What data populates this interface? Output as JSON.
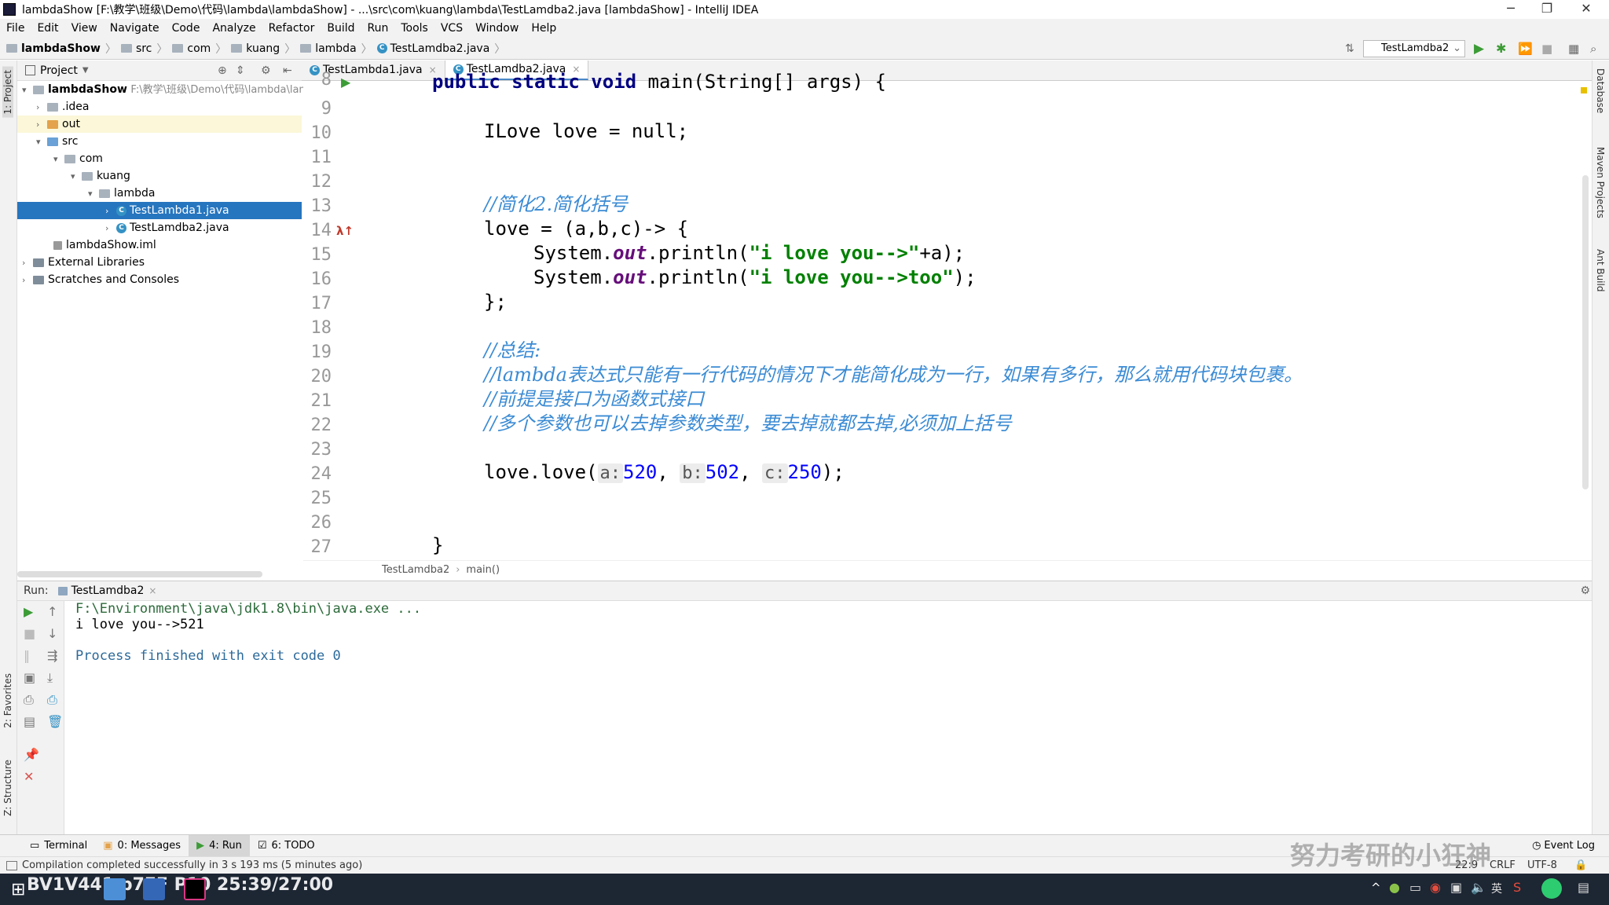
{
  "window": {
    "title": "lambdaShow [F:\\教学\\班级\\Demo\\代码\\lambda\\lambdaShow] - ...\\src\\com\\kuang\\lambda\\TestLamdba2.java [lambdaShow] - IntelliJ IDEA",
    "min": "─",
    "max": "❐",
    "close": "✕"
  },
  "menu": [
    "File",
    "Edit",
    "View",
    "Navigate",
    "Code",
    "Analyze",
    "Refactor",
    "Build",
    "Run",
    "Tools",
    "VCS",
    "Window",
    "Help"
  ],
  "breadcrumb": [
    "lambdaShow",
    "src",
    "com",
    "kuang",
    "lambda",
    "TestLamdba2.java"
  ],
  "run_config": "TestLamdba2",
  "project_panel": {
    "title": "Project",
    "tree": [
      {
        "label": "lambdaShow",
        "extra": "F:\\教学\\班级\\Demo\\代码\\lambda\\lam"
      },
      {
        "label": ".idea"
      },
      {
        "label": "out"
      },
      {
        "label": "src"
      },
      {
        "label": "com"
      },
      {
        "label": "kuang"
      },
      {
        "label": "lambda"
      },
      {
        "label": "TestLambda1.java"
      },
      {
        "label": "TestLamdba2.java"
      },
      {
        "label": "lambdaShow.iml"
      },
      {
        "label": "External Libraries"
      },
      {
        "label": "Scratches and Consoles"
      }
    ]
  },
  "tabs": [
    "TestLambda1.java",
    "TestLamdba2.java"
  ],
  "left_strip": {
    "project": "1: Project",
    "favorites": "2: Favorites",
    "structure": "Z: Structure"
  },
  "right_strip": [
    "Database",
    "Maven Projects",
    "Ant Build"
  ],
  "editor": {
    "line_numbers": [
      "8",
      "9",
      "10",
      "11",
      "12",
      "13",
      "14",
      "15",
      "16",
      "17",
      "18",
      "19",
      "20",
      "21",
      "22",
      "23",
      "24",
      "25",
      "26",
      "27"
    ],
    "lines": {
      "l8_a": "public static void",
      "l8_b": " main(String[] args) {",
      "l10": "ILove love = null;",
      "l13": "//简化2.简化括号",
      "l14": "love = (a,b,c)-> {",
      "l15_a": "System.",
      "l15_b": "out",
      "l15_c": ".println(",
      "l15_d": "\"i love you-->\"",
      "l15_e": "+a);",
      "l16_a": "System.",
      "l16_b": "out",
      "l16_c": ".println(",
      "l16_d": "\"i love you-->too\"",
      "l16_e": ");",
      "l17": "};",
      "l19": "//总结:",
      "l20": "//lambda表达式只能有一行代码的情况下才能简化成为一行，如果有多行，那么就用代码块包裹。",
      "l21": "//前提是接口为函数式接口",
      "l22": "//多个参数也可以去掉参数类型，要去掉就都去掉,必须加上括号",
      "l24_a": "love.love(",
      "l24_ha": "a:",
      "l24_va": "520",
      "l24_sep1": ", ",
      "l24_hb": "b:",
      "l24_vb": "502",
      "l24_sep2": ", ",
      "l24_hc": "c:",
      "l24_vc": "250",
      "l24_end": ");",
      "l27": "}"
    },
    "crumbs": [
      "TestLamdba2",
      "main()"
    ]
  },
  "run_panel": {
    "label": "Run:",
    "tab": "TestLamdba2",
    "output": [
      "F:\\Environment\\java\\jdk1.8\\bin\\java.exe ...",
      "i love you-->521",
      "",
      "Process finished with exit code 0"
    ]
  },
  "bottom_tabs": [
    "Terminal",
    "0: Messages",
    "4: Run",
    "6: TODO"
  ],
  "event_log": "Event Log",
  "status": {
    "message": "Compilation completed successfully in 3 s 193 ms (5 minutes ago)",
    "position": "22:9",
    "line_sep": "CRLF",
    "encoding": "UTF-8"
  },
  "overlay": {
    "video_info": "BV1V441 p7EF P10 25:39/27:00",
    "watermark": "努力考研的小狂神"
  },
  "colors": {
    "accent": "#4a88c7",
    "selection": "#2675bf",
    "comment": "#3b8bd4",
    "string": "#008000",
    "keyword": "#000080"
  }
}
